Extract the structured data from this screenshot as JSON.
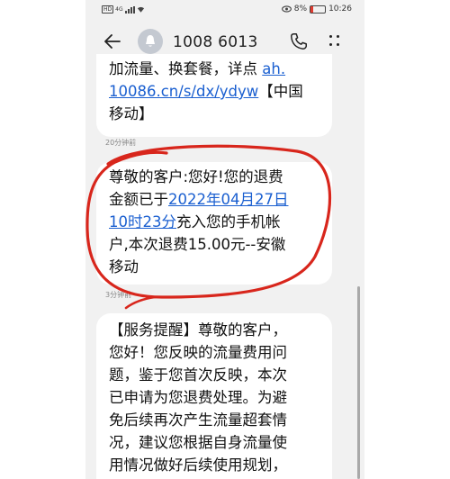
{
  "status_bar": {
    "sim_label": "HD",
    "network": "4G",
    "battery_percent": "8%",
    "time": "10:26",
    "battery_level": 0.08
  },
  "header": {
    "contact_number": "1008 6013"
  },
  "messages": [
    {
      "line1": "加流量、换套餐，详点 ",
      "link1": "ah.",
      "link2": "10086.cn/s/dx/ydyw",
      "line2_tail": "【中国",
      "line3": "移动】",
      "timestamp": "20分钟前"
    },
    {
      "line1": "尊敬的客户:您好!您的退费",
      "line2_pre": "金额已于",
      "link_date1": "2022年04月27日",
      "link_date2": "10时23分",
      "line3_tail": "充入您的手机帐",
      "line4": "户,本次退费15.00元--安徽",
      "line5": "移动",
      "timestamp": "3分钟前"
    },
    {
      "line1": "【服务提醒】尊敬的客户，",
      "line2": "您好！您反映的流量费用问",
      "line3": "题，鉴于您首次反映，本次",
      "line4": "已申请为您退费处理。为避",
      "line5": "免后续再次产生流量超套情",
      "line6": "况，建议您根据自身流量使",
      "line7": "用情况做好后续使用规划，"
    }
  ],
  "colors": {
    "link": "#1a5fd0",
    "annotation": "#d8261c",
    "bubble": "#ffffff",
    "background": "#f1f1f1"
  },
  "icons": [
    "back-arrow-icon",
    "contact-avatar-icon",
    "phone-call-icon",
    "more-options-icon",
    "eye-icon",
    "battery-icon",
    "signal-icon"
  ]
}
